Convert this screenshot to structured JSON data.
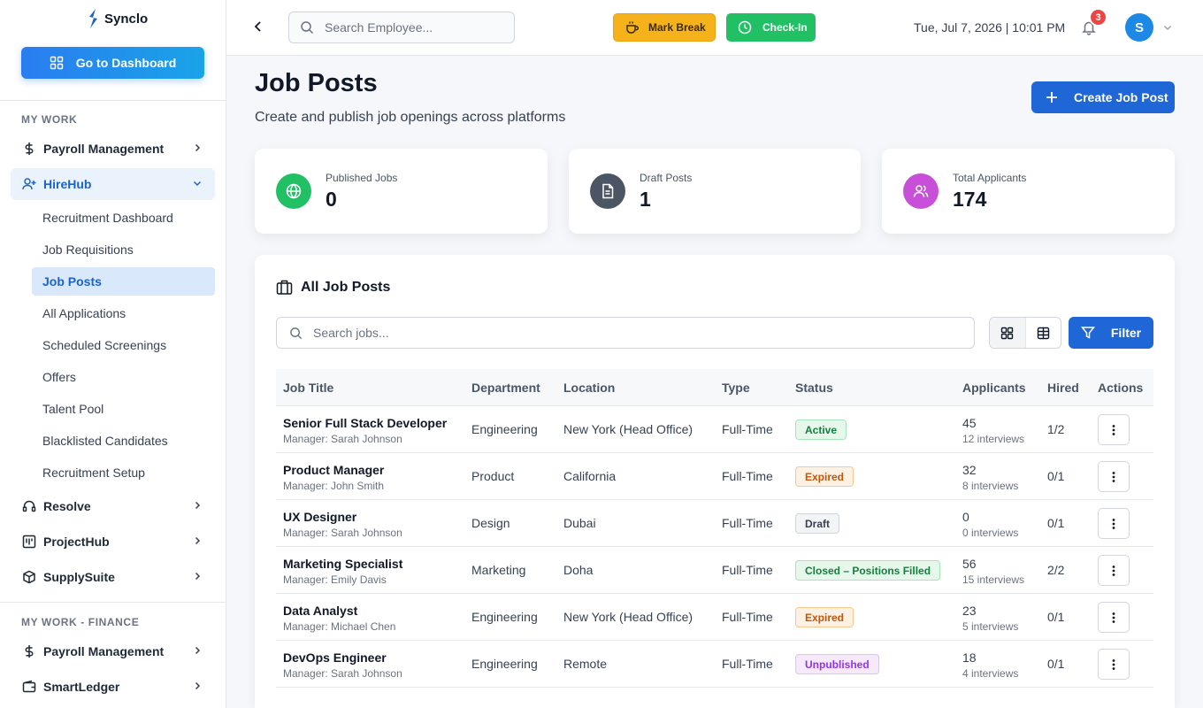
{
  "app": {
    "name": "Synclo"
  },
  "sidebar": {
    "dashboard_button": "Go to Dashboard",
    "section_my_work": "MY WORK",
    "section_finance": "MY WORK - FINANCE",
    "payroll": "Payroll Management",
    "hirehub": "HireHub",
    "hirehub_sub": [
      "Recruitment Dashboard",
      "Job Requisitions",
      "Job Posts",
      "All Applications",
      "Scheduled Screenings",
      "Offers",
      "Talent Pool",
      "Blacklisted Candidates",
      "Recruitment Setup"
    ],
    "resolve": "Resolve",
    "projecthub": "ProjectHub",
    "supplysuite": "SupplySuite",
    "payroll_finance": "Payroll Management",
    "smartledger": "SmartLedger"
  },
  "topbar": {
    "search_placeholder": "Search Employee...",
    "mark_break": "Mark Break",
    "check_in": "Check-In",
    "datetime": "Tue, Jul 7, 2026 | 10:01 PM",
    "notification_count": "3",
    "avatar_initial": "S"
  },
  "page": {
    "title": "Job Posts",
    "subtitle": "Create and publish job openings across platforms",
    "create_button": "Create Job Post"
  },
  "stats": [
    {
      "label": "Published Jobs",
      "value": "0",
      "icon": "globe-icon",
      "color": "#22c065"
    },
    {
      "label": "Draft Posts",
      "value": "1",
      "icon": "document-icon",
      "color": "#4b5563"
    },
    {
      "label": "Total Applicants",
      "value": "174",
      "icon": "users-icon",
      "color": "#c84fd8"
    }
  ],
  "panel": {
    "title": "All Job Posts",
    "search_placeholder": "Search jobs...",
    "filter_button": "Filter"
  },
  "table": {
    "headers": [
      "Job Title",
      "Department",
      "Location",
      "Type",
      "Status",
      "Applicants",
      "Hired",
      "Actions"
    ],
    "rows": [
      {
        "title": "Senior Full Stack Developer",
        "manager": "Manager: Sarah Johnson",
        "department": "Engineering",
        "location": "New York (Head Office)",
        "type": "Full-Time",
        "status": "Active",
        "applicants": "45",
        "interviews": "12 interviews",
        "hired": "1/2"
      },
      {
        "title": "Product Manager",
        "manager": "Manager: John Smith",
        "department": "Product",
        "location": "California",
        "type": "Full-Time",
        "status": "Expired",
        "applicants": "32",
        "interviews": "8 interviews",
        "hired": "0/1"
      },
      {
        "title": "UX Designer",
        "manager": "Manager: Sarah Johnson",
        "department": "Design",
        "location": "Dubai",
        "type": "Full-Time",
        "status": "Draft",
        "applicants": "0",
        "interviews": "0 interviews",
        "hired": "0/1"
      },
      {
        "title": "Marketing Specialist",
        "manager": "Manager: Emily Davis",
        "department": "Marketing",
        "location": "Doha",
        "type": "Full-Time",
        "status": "Closed – Positions Filled",
        "applicants": "56",
        "interviews": "15 interviews",
        "hired": "2/2"
      },
      {
        "title": "Data Analyst",
        "manager": "Manager: Michael Chen",
        "department": "Engineering",
        "location": "New York (Head Office)",
        "type": "Full-Time",
        "status": "Expired",
        "applicants": "23",
        "interviews": "5 interviews",
        "hired": "0/1"
      },
      {
        "title": "DevOps Engineer",
        "manager": "Manager: Sarah Johnson",
        "department": "Engineering",
        "location": "Remote",
        "type": "Full-Time",
        "status": "Unpublished",
        "applicants": "18",
        "interviews": "4 interviews",
        "hired": "0/1"
      }
    ]
  },
  "status_colors": {
    "Active": {
      "bg": "#e6f7ec",
      "border": "#a7e3bd",
      "text": "#15803d"
    },
    "Expired": {
      "bg": "#fdf1e3",
      "border": "#f5c991",
      "text": "#c2560c"
    },
    "Draft": {
      "bg": "#f3f4f6",
      "border": "#d1d5db",
      "text": "#374151"
    },
    "Closed – Positions Filled": {
      "bg": "#e6f7ec",
      "border": "#a7e3bd",
      "text": "#15803d"
    },
    "Unpublished": {
      "bg": "#f5e9fb",
      "border": "#e2c2f2",
      "text": "#9333ea"
    }
  }
}
